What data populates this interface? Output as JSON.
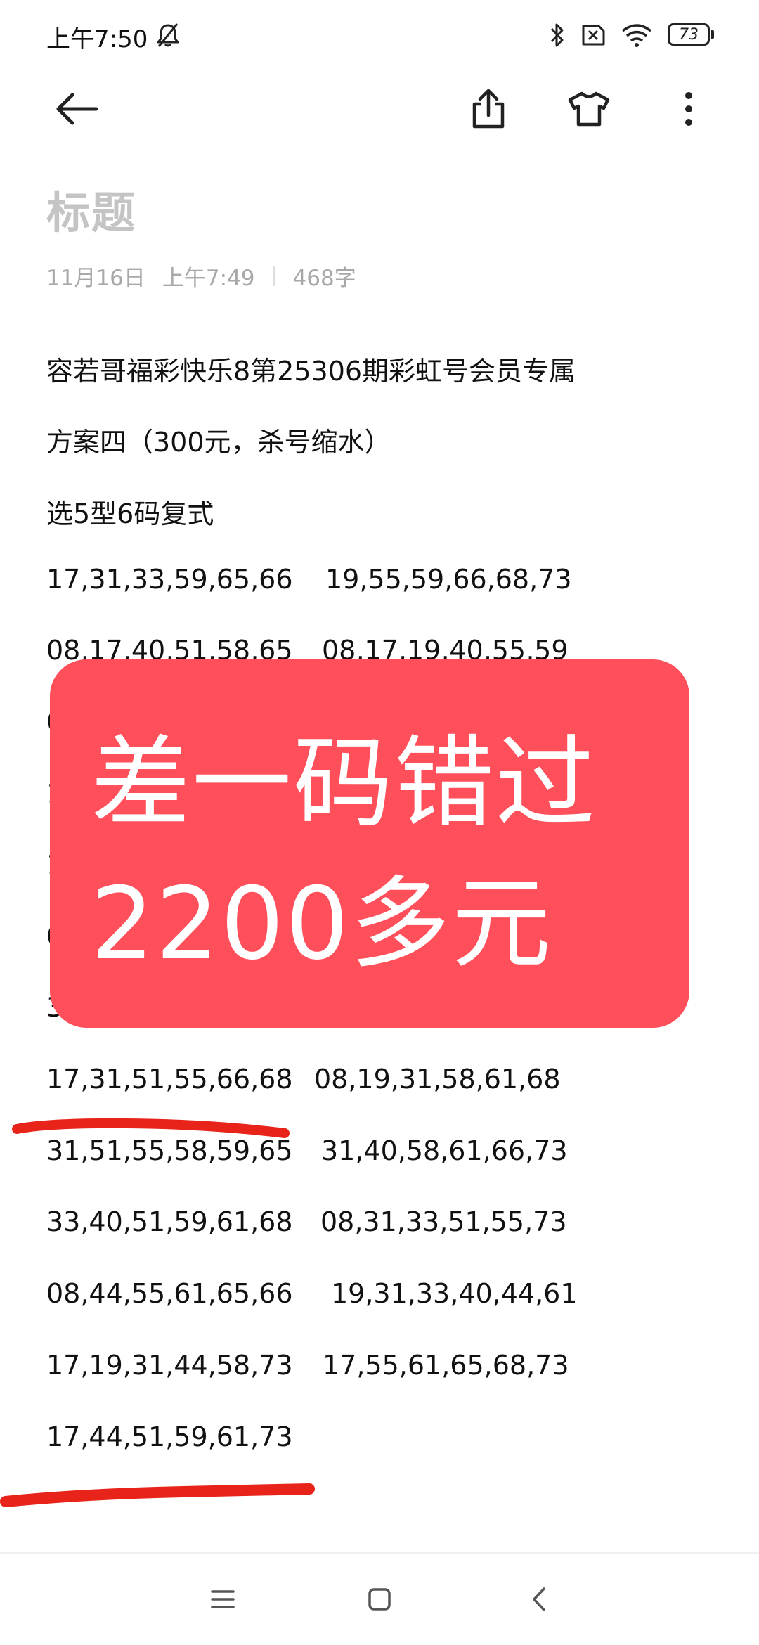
{
  "status_bar": {
    "time": "上午7:50",
    "battery_level": "73",
    "icons": [
      "mute-bell-icon",
      "bluetooth-icon",
      "sim-off-icon",
      "wifi-icon",
      "battery-icon"
    ]
  },
  "toolbar": {
    "icons": [
      "back-arrow-icon",
      "share-icon",
      "theme-shirt-icon",
      "more-vertical-icon"
    ]
  },
  "note": {
    "title": "标题",
    "date": "11月16日",
    "time": "上午7:49",
    "word_count": "468字",
    "heading": "容若哥福彩快乐8第25306期彩虹号会员专属",
    "plan": "方案四（300元，杀号缩水）",
    "type": "选5型6码复式",
    "rows": [
      {
        "a": "17,31,33,59,65,66",
        "b": "19,55,59,66,68,73"
      },
      {
        "a": "08,17,40,51,58,65",
        "b": "08,17,19,40,55,59"
      },
      {
        "a": "17,31,51,55,66,68",
        "b": "08,19,31,58,61,68"
      },
      {
        "a": "31,51,55,58,59,65",
        "b": "31,40,58,61,66,73"
      },
      {
        "a": "33,40,51,59,61,68",
        "b": "08,31,33,51,55,73"
      },
      {
        "a": "08,44,55,61,65,66",
        "b": "19,31,33,40,44,61"
      },
      {
        "a": "17,19,31,44,58,73",
        "b": "17,55,61,65,68,73"
      },
      {
        "a": "17,44,51,59,61,73",
        "b": ""
      }
    ],
    "hidden_row_starts": [
      "0",
      "1",
      "1",
      "0",
      "3"
    ]
  },
  "overlay": {
    "line1": "差一码错过",
    "line2": "2200多元",
    "color": "#ff4f5a"
  },
  "nav_bar": {
    "icons": [
      "menu-icon",
      "home-square-icon",
      "back-chevron-icon"
    ]
  },
  "colors": {
    "annotation_stroke": "#e8231a"
  }
}
